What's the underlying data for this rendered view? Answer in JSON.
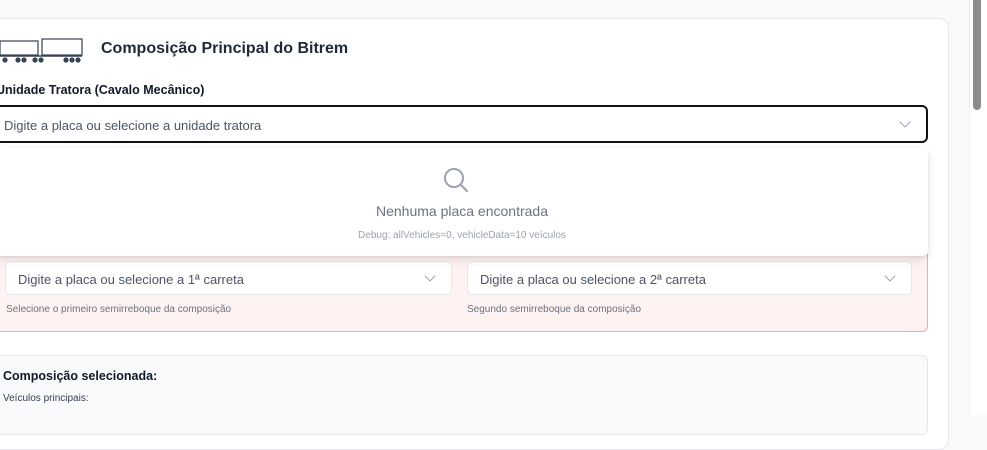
{
  "header": {
    "title": "Composição Principal do Bitrem",
    "icon": "bitrem-truck-icon"
  },
  "tractor": {
    "label": "Unidade Tratora (Cavalo Mecânico)",
    "placeholder": "Digite a placa ou selecione a unidade tratora"
  },
  "dropdown": {
    "empty_message": "Nenhuma placa encontrada",
    "debug": "Debug: allVehicles=0, vehicleData=10 veículos"
  },
  "trailers": [
    {
      "placeholder": "Digite a placa ou selecione a 1ª carreta",
      "help": "Selecione o primeiro semirreboque da composição"
    },
    {
      "placeholder": "Digite a placa ou selecione a 2ª carreta",
      "help": "Segundo semirreboque da composição"
    }
  ],
  "summary": {
    "title": "Composição selecionada:",
    "subtitle": "Veículos principais:"
  },
  "colors": {
    "error_bg": "#fef2f2",
    "error_border": "#fca5a5",
    "focus_border": "#111111"
  }
}
